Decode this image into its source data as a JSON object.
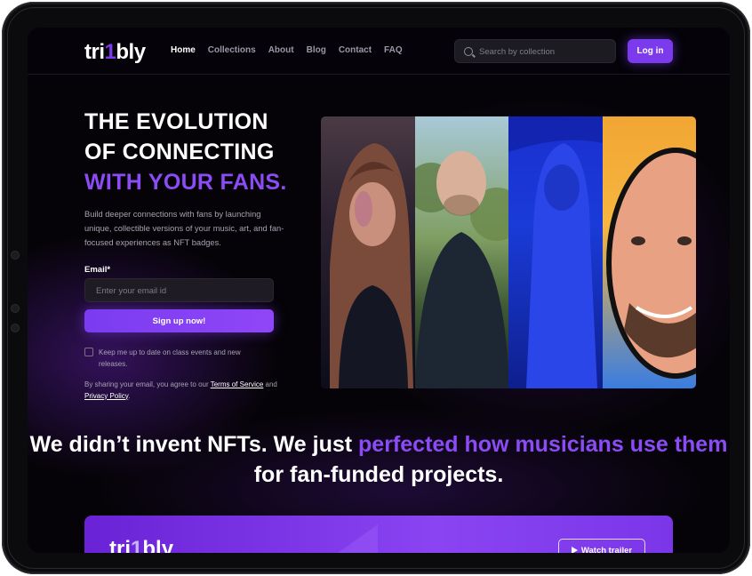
{
  "brand": {
    "logo_pre": "tri",
    "logo_mid": "1",
    "logo_post": "bly"
  },
  "nav": {
    "links": [
      "Home",
      "Collections",
      "About",
      "Blog",
      "Contact",
      "FAQ"
    ],
    "active": "Home",
    "search_placeholder": "Search by collection",
    "login_label": "Log in"
  },
  "hero": {
    "title_line1": "THE EVOLUTION",
    "title_line2": "OF CONNECTING",
    "title_line3": "WITH YOUR FANS.",
    "description": "Build deeper connections with fans by launching unique, collectible versions of your music, art, and fan-focused experiences as NFT badges.",
    "email_label": "Email*",
    "email_placeholder": "Enter your email id",
    "signup_label": "Sign up now!",
    "checkbox_label": "Keep me up to date on class events and new releases.",
    "legal_prefix": "By sharing your email, you agree to our ",
    "terms_label": "Terms of Service",
    "legal_and": " and ",
    "privacy_label": "Privacy Policy",
    "legal_suffix": "."
  },
  "headline": {
    "part1": "We didn’t invent NFTs. We just ",
    "highlight": "perfected how musicians use them",
    "part2": " for fan-funded projects."
  },
  "banner": {
    "watch_label": "Watch trailer"
  },
  "colors": {
    "accent": "#7c3aed",
    "background": "#050307"
  }
}
